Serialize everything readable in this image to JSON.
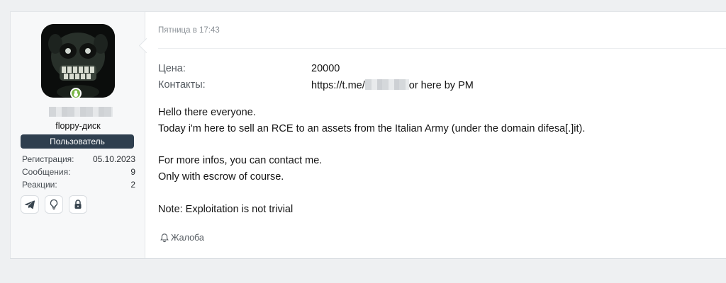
{
  "author": {
    "name_visible": "floppy-диск",
    "role": "Пользователь",
    "online_status_icon": "online-indicator-icon",
    "stats": [
      {
        "label": "Регистрация:",
        "value": "05.10.2023"
      },
      {
        "label": "Сообщения:",
        "value": "9"
      },
      {
        "label": "Реакции:",
        "value": "2"
      }
    ],
    "badges": [
      "telegram-icon",
      "lightbulb-icon",
      "lock-icon"
    ]
  },
  "post": {
    "timestamp": "Пятница в 17:43",
    "fields": [
      {
        "label": "Цена:",
        "value": "20000"
      },
      {
        "label": "Контакты:",
        "value_prefix": "https://t.me/",
        "value_suffix": "or here by PM"
      }
    ],
    "body_lines": [
      "Hello there everyone.",
      "Today i'm here to sell an RCE to an assets from the Italian Army (under the domain difesa[.]it).",
      "For more infos, you can contact me.",
      "Only with escrow of course.",
      "Note: Exploitation is not trivial"
    ],
    "report_label": "Жалоба"
  },
  "colors": {
    "page_background": "#eef0f2",
    "sidebar_background": "#f7f8f9",
    "role_badge": "#2f3f4f",
    "online": "#7ab648",
    "muted_text": "#8a9096"
  }
}
